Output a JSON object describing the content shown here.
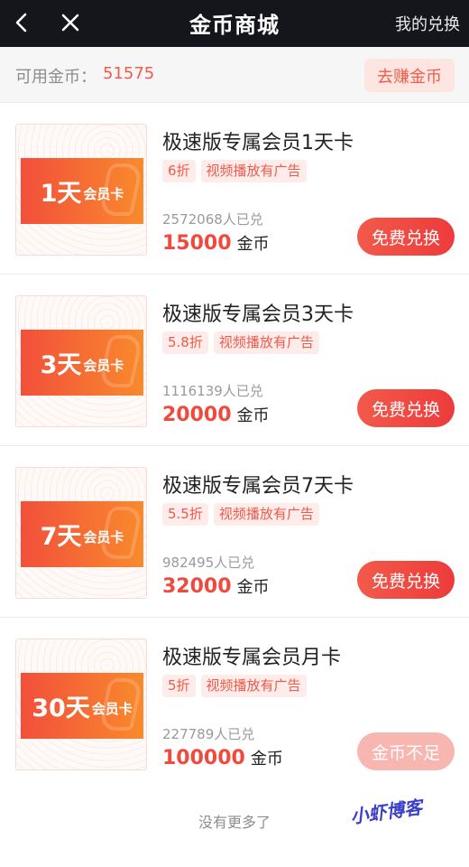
{
  "header": {
    "title": "金币商城",
    "right_link": "我的兑换"
  },
  "balance": {
    "label": "可用金币：",
    "value": "51575",
    "earn_button": "去赚金币"
  },
  "items": [
    {
      "title": "极速版专属会员1天卡",
      "card_days": "1天",
      "card_member": "会员卡",
      "tags": [
        "6折",
        "视频播放有广告"
      ],
      "sold": "2572068人已兑",
      "price": "15000",
      "unit": "金币",
      "button": "免费兑换",
      "button_enabled": true
    },
    {
      "title": "极速版专属会员3天卡",
      "card_days": "3天",
      "card_member": "会员卡",
      "tags": [
        "5.8折",
        "视频播放有广告"
      ],
      "sold": "1116139人已兑",
      "price": "20000",
      "unit": "金币",
      "button": "免费兑换",
      "button_enabled": true
    },
    {
      "title": "极速版专属会员7天卡",
      "card_days": "7天",
      "card_member": "会员卡",
      "tags": [
        "5.5折",
        "视频播放有广告"
      ],
      "sold": "982495人已兑",
      "price": "32000",
      "unit": "金币",
      "button": "免费兑换",
      "button_enabled": true
    },
    {
      "title": "极速版专属会员月卡",
      "card_days": "30天",
      "card_member": "会员卡",
      "tags": [
        "5折",
        "视频播放有广告"
      ],
      "sold": "227789人已兑",
      "price": "100000",
      "unit": "金币",
      "button": "金币不足",
      "button_enabled": false
    }
  ],
  "footer": {
    "no_more": "没有更多了",
    "watermark": "小虾博客"
  }
}
